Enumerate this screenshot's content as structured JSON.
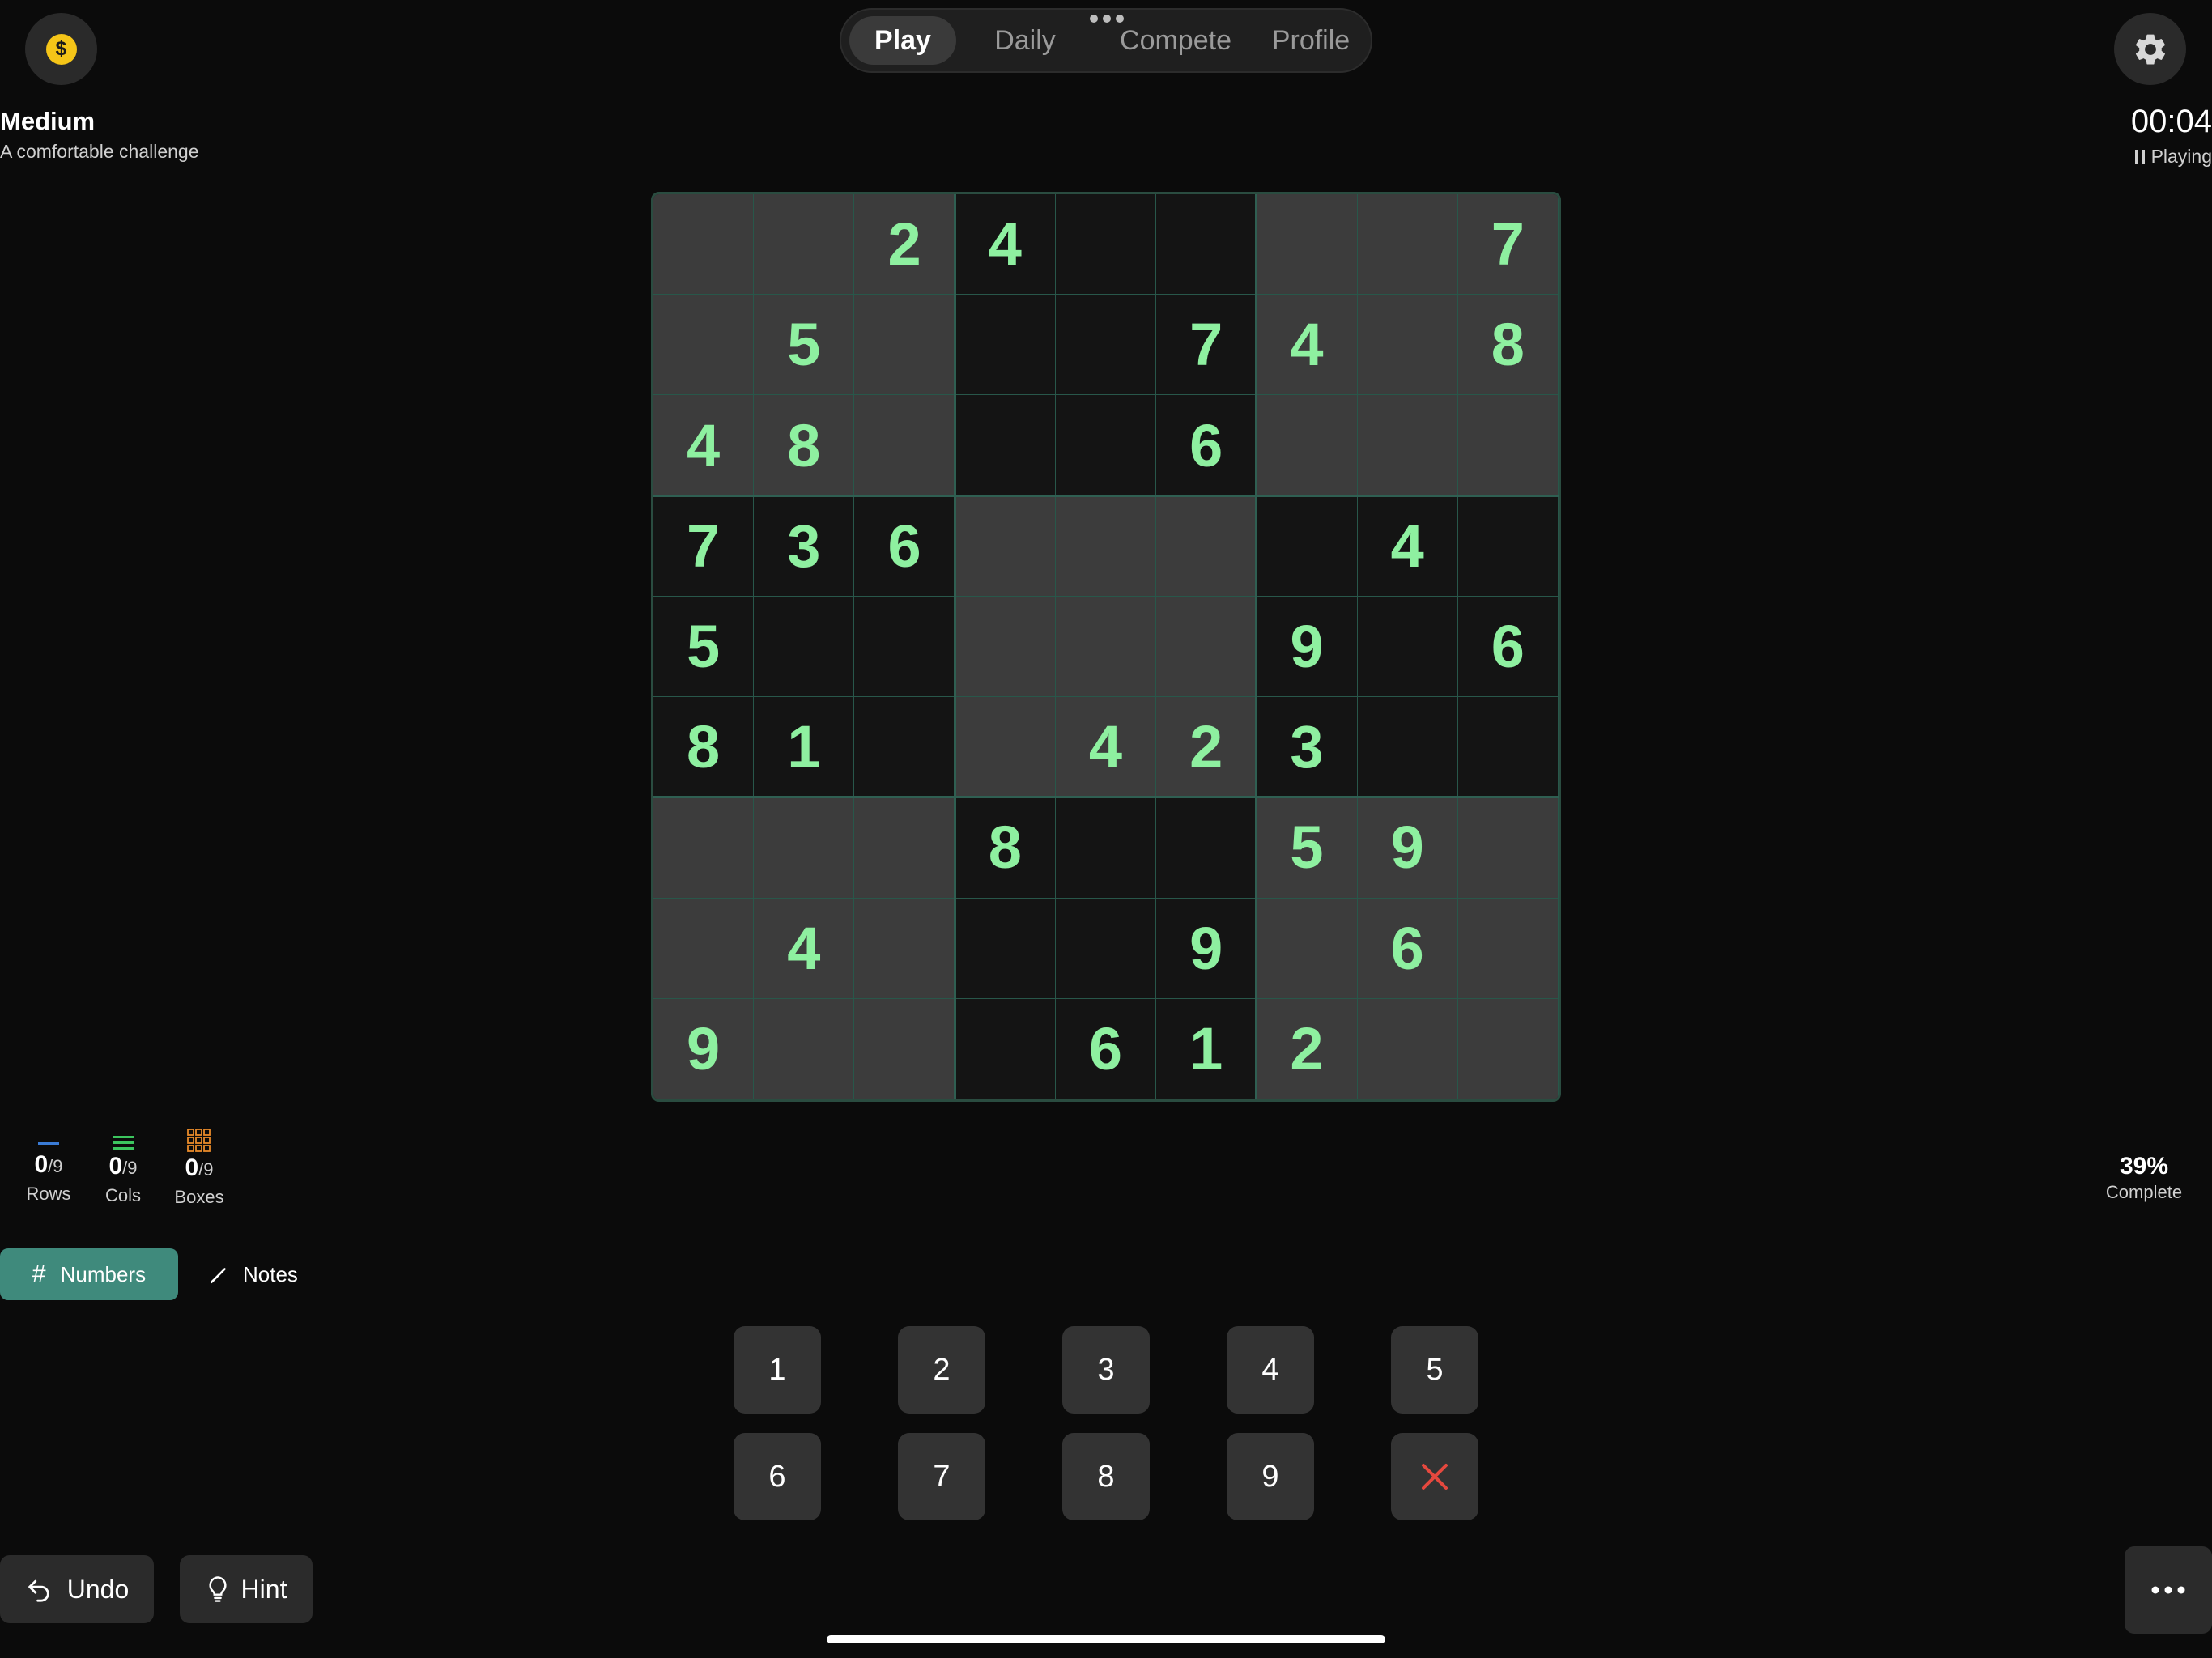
{
  "header": {
    "coin_symbol": "$",
    "tabs": [
      "Play",
      "Daily",
      "Compete",
      "Profile"
    ],
    "active_tab": "Play"
  },
  "difficulty": {
    "title": "Medium",
    "subtitle": "A comfortable challenge"
  },
  "timer": {
    "time": "00:04",
    "status": "Playing"
  },
  "board": {
    "cells": [
      [
        0,
        0,
        2,
        4,
        0,
        0,
        0,
        0,
        7
      ],
      [
        0,
        5,
        0,
        0,
        0,
        7,
        4,
        0,
        8
      ],
      [
        4,
        8,
        0,
        0,
        0,
        6,
        0,
        0,
        0
      ],
      [
        7,
        3,
        6,
        0,
        0,
        0,
        0,
        4,
        0
      ],
      [
        5,
        0,
        0,
        0,
        0,
        0,
        9,
        0,
        6
      ],
      [
        8,
        1,
        0,
        0,
        4,
        2,
        3,
        0,
        0
      ],
      [
        0,
        0,
        0,
        8,
        0,
        0,
        5,
        9,
        0
      ],
      [
        0,
        4,
        0,
        0,
        0,
        9,
        0,
        6,
        0
      ],
      [
        9,
        0,
        0,
        0,
        6,
        1,
        2,
        0,
        0
      ]
    ],
    "highlighted_cells": [
      [
        0,
        0
      ],
      [
        0,
        1
      ],
      [
        0,
        2
      ],
      [
        0,
        6
      ],
      [
        0,
        7
      ],
      [
        0,
        8
      ],
      [
        1,
        0
      ],
      [
        1,
        1
      ],
      [
        1,
        2
      ],
      [
        1,
        6
      ],
      [
        1,
        7
      ],
      [
        1,
        8
      ],
      [
        2,
        0
      ],
      [
        2,
        1
      ],
      [
        2,
        2
      ],
      [
        2,
        6
      ],
      [
        2,
        7
      ],
      [
        2,
        8
      ],
      [
        3,
        3
      ],
      [
        3,
        4
      ],
      [
        3,
        5
      ],
      [
        4,
        3
      ],
      [
        4,
        4
      ],
      [
        4,
        5
      ],
      [
        5,
        3
      ],
      [
        5,
        4
      ],
      [
        5,
        5
      ],
      [
        6,
        0
      ],
      [
        6,
        1
      ],
      [
        6,
        2
      ],
      [
        6,
        6
      ],
      [
        6,
        7
      ],
      [
        6,
        8
      ],
      [
        7,
        0
      ],
      [
        7,
        1
      ],
      [
        7,
        2
      ],
      [
        7,
        6
      ],
      [
        7,
        7
      ],
      [
        7,
        8
      ],
      [
        8,
        0
      ],
      [
        8,
        1
      ],
      [
        8,
        2
      ],
      [
        8,
        6
      ],
      [
        8,
        7
      ],
      [
        8,
        8
      ]
    ],
    "digit_color": "#8ef0a0"
  },
  "progress": {
    "rows": {
      "count": "0",
      "total": "/9",
      "label": "Rows",
      "color": "#3a7bd5"
    },
    "cols": {
      "count": "0",
      "total": "/9",
      "label": "Cols",
      "color": "#3cc55e"
    },
    "boxes": {
      "count": "0",
      "total": "/9",
      "label": "Boxes",
      "color": "#e88a2a"
    },
    "complete_percent": "39%",
    "complete_label": "Complete"
  },
  "modes": {
    "numbers_label": "Numbers",
    "notes_label": "Notes",
    "active": "Numbers"
  },
  "keypad": {
    "keys": [
      "1",
      "2",
      "3",
      "4",
      "5",
      "6",
      "7",
      "8",
      "9"
    ],
    "erase_color": "#e5483e"
  },
  "actions": {
    "undo_label": "Undo",
    "hint_label": "Hint"
  }
}
